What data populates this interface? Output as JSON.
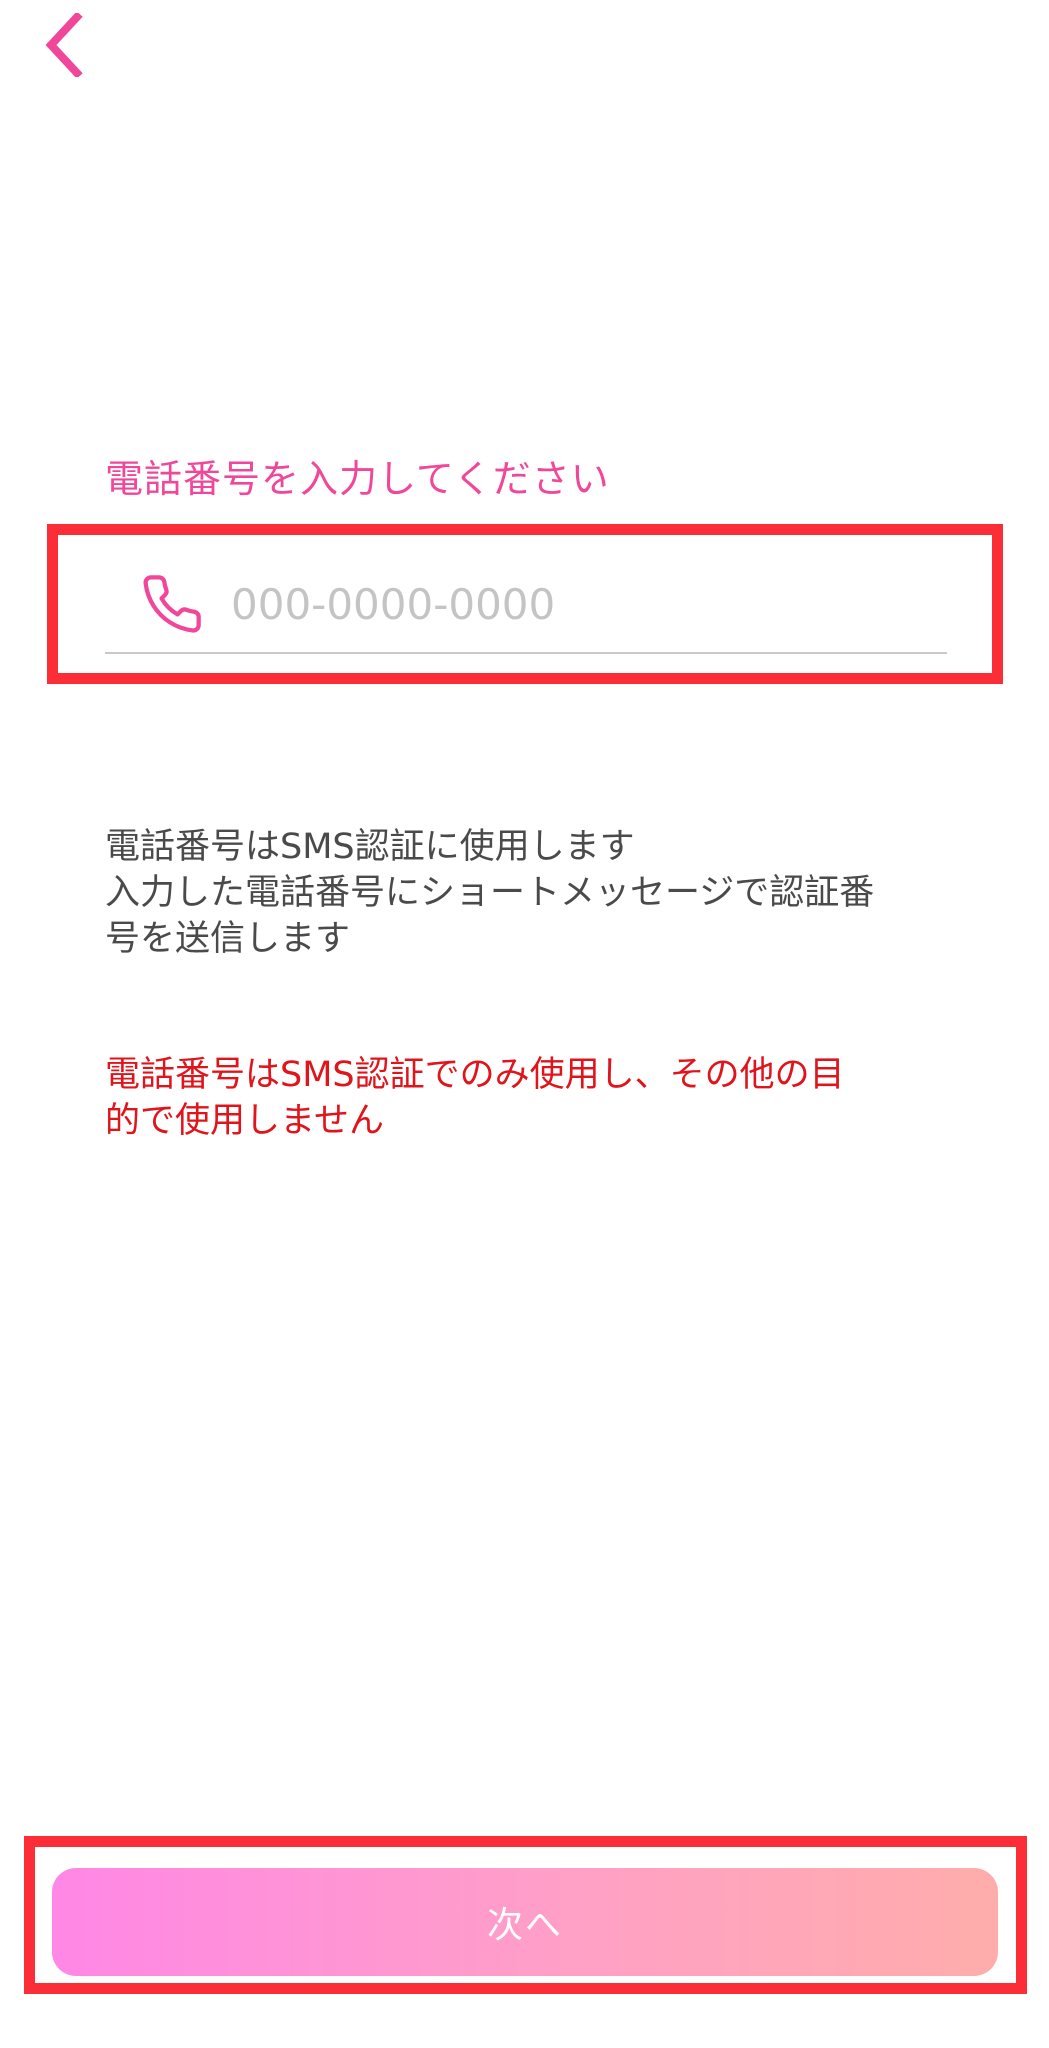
{
  "header": {
    "back_icon": "chevron-left-icon"
  },
  "form": {
    "title": "電話番号を入力してください",
    "phone_icon": "phone-icon",
    "phone_placeholder": "000-0000-0000",
    "phone_value": ""
  },
  "info": {
    "line1": "電話番号はSMS認証に使用します",
    "line2": "入力した電話番号にショートメッセージで認証番",
    "line3": "号を送信します"
  },
  "warning": {
    "line1": "電話番号はSMS認証でのみ使用し、その他の目",
    "line2": "的で使用しません"
  },
  "footer": {
    "next_label": "次へ"
  },
  "colors": {
    "accent_pink": "#f0479a",
    "warning_red": "#e0141b",
    "annotation_red": "#fb2d36",
    "gradient_start": "#ff87e6",
    "gradient_end": "#ffadab"
  }
}
